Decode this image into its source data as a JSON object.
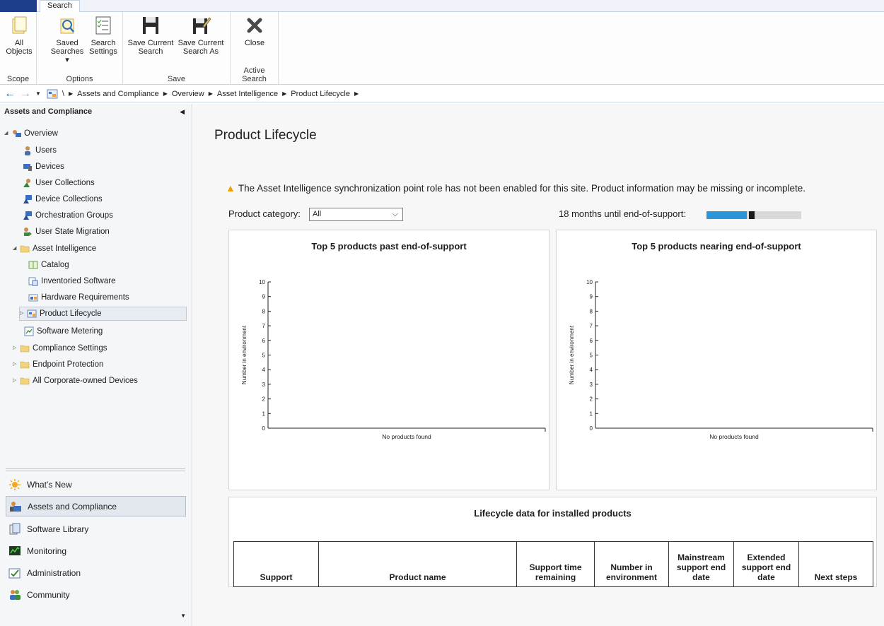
{
  "ribbon": {
    "active_tab": "Search",
    "groups": [
      {
        "label": "Scope",
        "buttons": [
          {
            "label_line1": "All",
            "label_line2": "Objects"
          }
        ]
      },
      {
        "label": "Options",
        "buttons": [
          {
            "label_line1": "Saved",
            "label_line2": "Searches ▾"
          },
          {
            "label_line1": "Search",
            "label_line2": "Settings"
          }
        ]
      },
      {
        "label": "Save",
        "buttons": [
          {
            "label_line1": "Save Current",
            "label_line2": "Search"
          },
          {
            "label_line1": "Save Current",
            "label_line2": "Search As"
          }
        ]
      },
      {
        "label": "Active Search",
        "buttons": [
          {
            "label_line1": "Close",
            "label_line2": ""
          }
        ]
      }
    ]
  },
  "address": {
    "root": "\\",
    "crumbs": [
      "Assets and Compliance",
      "Overview",
      "Asset Intelligence",
      "Product Lifecycle"
    ]
  },
  "sidebar": {
    "title": "Assets and Compliance",
    "items": [
      {
        "label": "Overview"
      },
      {
        "label": "Users"
      },
      {
        "label": "Devices"
      },
      {
        "label": "User Collections"
      },
      {
        "label": "Device Collections"
      },
      {
        "label": "Orchestration Groups"
      },
      {
        "label": "User State Migration"
      },
      {
        "label": "Asset Intelligence"
      },
      {
        "label": "Catalog"
      },
      {
        "label": "Inventoried Software"
      },
      {
        "label": "Hardware Requirements"
      },
      {
        "label": "Product Lifecycle"
      },
      {
        "label": "Software Metering"
      },
      {
        "label": "Compliance Settings"
      },
      {
        "label": "Endpoint Protection"
      },
      {
        "label": "All Corporate-owned Devices"
      }
    ],
    "workspaces": [
      {
        "label": "What's New"
      },
      {
        "label": "Assets and Compliance"
      },
      {
        "label": "Software Library"
      },
      {
        "label": "Monitoring"
      },
      {
        "label": "Administration"
      },
      {
        "label": "Community"
      }
    ]
  },
  "main": {
    "title": "Product Lifecycle",
    "warning": "The Asset Intelligence synchronization point role has not been enabled for this site. Product information may be missing or incomplete.",
    "category_label": "Product category:",
    "category_value": "All",
    "months_label": "18 months until end-of-support:",
    "months_bar": {
      "fill_fraction": 0.48,
      "marker_fraction": 0.48
    },
    "colors": {
      "accent": "#2b95d8",
      "warning": "#f0a000"
    },
    "table": {
      "title": "Lifecycle data for installed products",
      "columns": [
        {
          "line1": "Support",
          "line2": "",
          "line3": ""
        },
        {
          "line1": "Product name",
          "line2": "",
          "line3": ""
        },
        {
          "line1": "Support time",
          "line2": "remaining",
          "line3": ""
        },
        {
          "line1": "Number in",
          "line2": "environment",
          "line3": ""
        },
        {
          "line1": "Mainstream",
          "line2": "support end",
          "line3": "date"
        },
        {
          "line1": "Extended",
          "line2": "support end",
          "line3": "date"
        },
        {
          "line1": "Next steps",
          "line2": "",
          "line3": ""
        }
      ]
    }
  },
  "chart_data": [
    {
      "type": "bar",
      "title": "Top 5 products past end-of-support",
      "ylabel": "Number in environment",
      "xlabel": "No products found",
      "ylim": [
        0,
        10
      ],
      "yticks": [
        0,
        1,
        2,
        3,
        4,
        5,
        6,
        7,
        8,
        9,
        10
      ],
      "categories": [],
      "values": []
    },
    {
      "type": "bar",
      "title": "Top 5 products nearing end-of-support",
      "ylabel": "Number in environment",
      "xlabel": "No products found",
      "ylim": [
        0,
        10
      ],
      "yticks": [
        0,
        1,
        2,
        3,
        4,
        5,
        6,
        7,
        8,
        9,
        10
      ],
      "categories": [],
      "values": []
    }
  ]
}
